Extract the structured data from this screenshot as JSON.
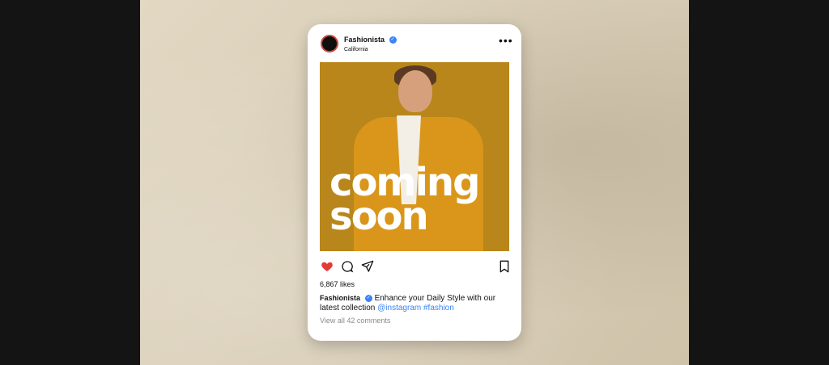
{
  "post": {
    "username": "Fashionista",
    "location": "California",
    "more_icon": "more-horizontal-icon",
    "image_text": [
      "coming",
      "soon"
    ],
    "likes": "6,867 likes",
    "caption": {
      "name": "Fashionista",
      "text": "Enhance your Daily Style with our latest collection",
      "tags": [
        "@instagram",
        "#fashion"
      ]
    },
    "view_comments": "View all 42 comments"
  },
  "colors": {
    "heart": "#e53935",
    "photo_bg": "#b8861b",
    "verified": "#3b82f6"
  }
}
